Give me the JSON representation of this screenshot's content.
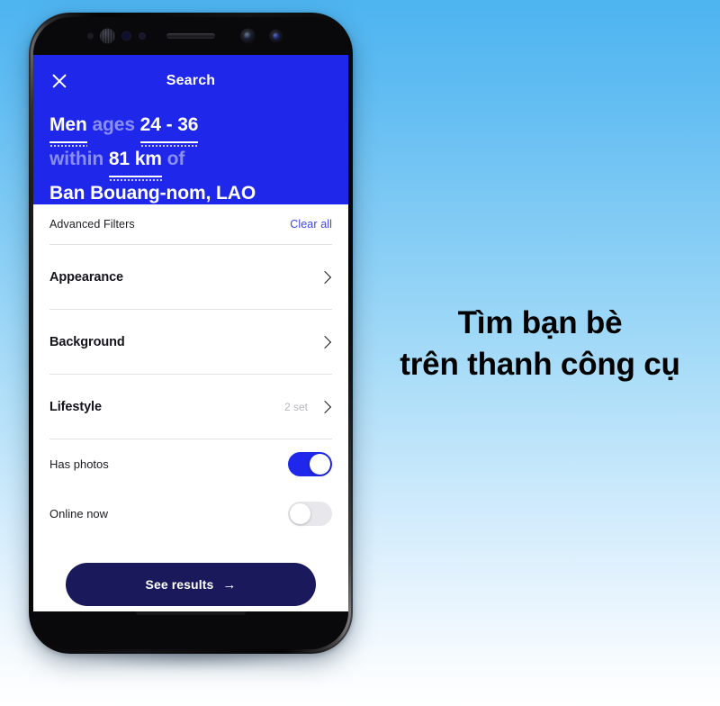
{
  "caption": {
    "line1": "Tìm bạn bè",
    "line2": "trên thanh công cụ"
  },
  "phone": {
    "hardware": {
      "earpiece_speaker": "earpiece-speaker",
      "iris_scanner": "iris-scanner",
      "front_camera": "front-camera",
      "proximity_sensor": "proximity-sensor",
      "ir_led": "ir-led",
      "light_sensor": "light-sensor"
    }
  },
  "screen": {
    "header": {
      "close_icon": "close-icon",
      "title": "Search",
      "query": {
        "gender": "Men",
        "ages_label": "ages",
        "age_range": "24 - 36",
        "within_label": "within",
        "distance": "81 km",
        "of_label": "of",
        "location": "Ban Bouang-nom, LAO"
      }
    },
    "filters": {
      "section_label": "Advanced Filters",
      "clear_all_label": "Clear all",
      "rows": [
        {
          "label": "Appearance",
          "count": ""
        },
        {
          "label": "Background",
          "count": ""
        },
        {
          "label": "Lifestyle",
          "count": "2 set"
        }
      ],
      "toggles": [
        {
          "label": "Has photos",
          "state": "on"
        },
        {
          "label": "Online now",
          "state": "off"
        }
      ]
    },
    "cta": {
      "label": "See results",
      "arrow": "→"
    }
  },
  "colors": {
    "header_blue": "#1e27ea",
    "accent_link": "#3b47e8",
    "cta_navy": "#19195c",
    "toggle_on": "#1e27ea",
    "toggle_off": "#e7e7ec",
    "background_top": "#4db4f0",
    "background_bottom": "#ffffff"
  }
}
